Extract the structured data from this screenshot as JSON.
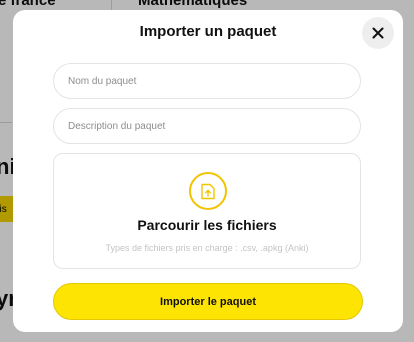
{
  "background": {
    "top_left": "e france",
    "top_right": "Mathématiques",
    "mid_left": "nis",
    "badge": "nis",
    "bottom_left": "yr"
  },
  "modal": {
    "title": "Importer un paquet",
    "close_icon": "close-icon",
    "name_field": {
      "placeholder": "Nom du paquet",
      "value": ""
    },
    "description_field": {
      "placeholder": "Description du paquet",
      "value": ""
    },
    "dropzone": {
      "icon": "file-upload-icon",
      "label": "Parcourir les fichiers",
      "hint": "Types de fichiers pris en charge : .csv, .apkg (Anki)"
    },
    "submit_label": "Importer le paquet"
  },
  "colors": {
    "accent": "#fde402",
    "icon_accent": "#f2c400",
    "overlay": "rgba(0,0,0,0.28)"
  }
}
